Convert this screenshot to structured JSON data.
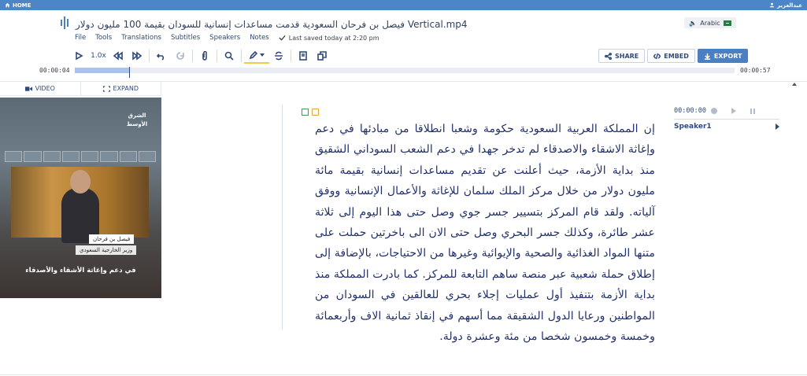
{
  "topbar": {
    "home_label": "HOME",
    "user_name": "عبدالعزيز"
  },
  "file": {
    "title": "فيصل بن فرحان السعودية قدمت مساعدات إنسانية للسودان بقيمة 100 مليون دولار Vertical.mp4"
  },
  "language": {
    "label": "Arabic"
  },
  "menu": {
    "items": [
      "File",
      "Tools",
      "Translations",
      "Subtitles",
      "Speakers",
      "Notes"
    ],
    "saved_text": "Last saved today at 2:20 pm"
  },
  "toolbar": {
    "speed": "1.0x"
  },
  "actions": {
    "share": "SHARE",
    "embed": "EMBED",
    "export": "EXPORT"
  },
  "timeline": {
    "current": "00:00:04",
    "total": "00:00:57",
    "progress": 0.082
  },
  "video_panel": {
    "tab_video": "VIDEO",
    "tab_expand": "EXPAND",
    "logo_text": "الشرق الأوسط",
    "name_box": "فيصل بن فرحان",
    "title_box": "وزير الخارجية السعودي",
    "caption": "في دعم وإغاثة الأشقاء والأصدقاء"
  },
  "transcript": {
    "text": "إن المملكة العربية السعودية حكومة وشعبا انطلاقا من مبادئها في دعم وإغاثة الاشقاء والاصدقاء لم تدخر جهدا في دعم الشعب السوداني الشقيق منذ بداية الأزمة، حيث أعلنت عن تقديم مساعدات إنسانية بقيمة مائة مليون دولار من خلال مركز الملك سلمان للإغاثة والأعمال الإنسانية ووفق آلياته. ولقد قام المركز بتسيير جسر جوي وصل حتى هذا اليوم إلى ثلاثة عشر طائرة، وكذلك جسر البحري وصل حتى الان الى باخرتين حملت على متنها المواد الغذائية والصحية والإيوائية وغيرها من الاحتياجات، بالإضافة إلى إطلاق حملة شعبية عبر منصة ساهم التابعة للمركز. كما بادرت المملكة منذ بداية الأزمة بتنفيذ أول عمليات إجلاء بحري للعالقين في السودان من المواطنين ورعايا الدول الشقيقة مما أسهم في إنقاذ ثمانية الاف وأربعمائة وخمسة وخمسون شخصا من مئة وعشرة دولة."
  },
  "speaker": {
    "time": "00:00:00",
    "name": "Speaker1"
  },
  "colors": {
    "accent": "#4a7fc1",
    "topbar": "#4a86c8",
    "text": "#21306a"
  }
}
